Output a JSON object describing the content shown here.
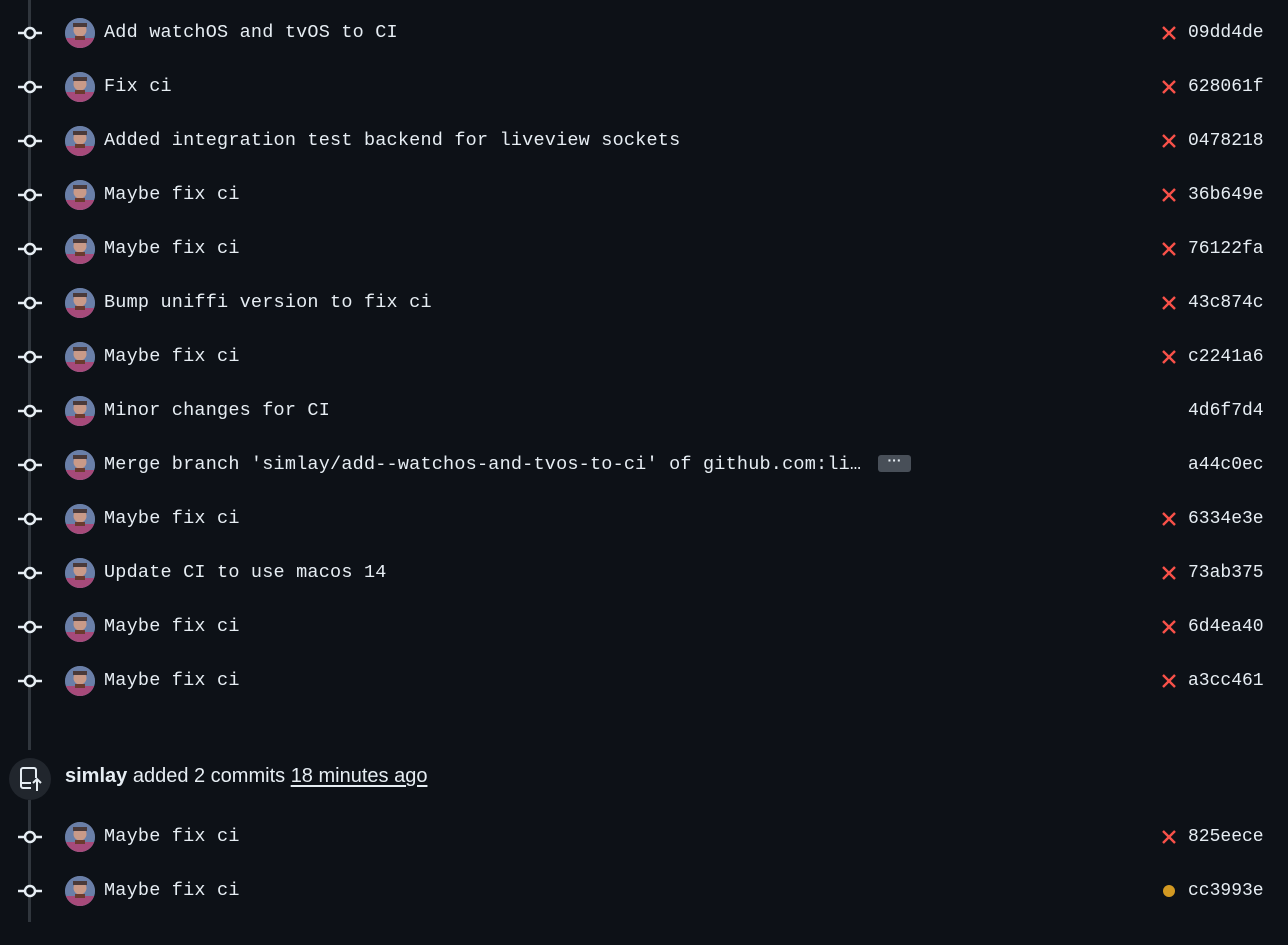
{
  "colors": {
    "background": "#0d1117",
    "timeline": "#30363d",
    "failure": "#f85149",
    "pending": "#d29922",
    "text": "#e6edf3"
  },
  "commits": [
    {
      "message": "Add watchOS and tvOS to CI",
      "sha": "09dd4de",
      "status": "failure"
    },
    {
      "message": "Fix ci",
      "sha": "628061f",
      "status": "failure"
    },
    {
      "message": "Added integration test backend for liveview sockets",
      "sha": "0478218",
      "status": "failure"
    },
    {
      "message": "Maybe fix ci",
      "sha": "36b649e",
      "status": "failure"
    },
    {
      "message": "Maybe fix ci",
      "sha": "76122fa",
      "status": "failure"
    },
    {
      "message": "Bump uniffi version to fix ci",
      "sha": "43c874c",
      "status": "failure"
    },
    {
      "message": "Maybe fix ci",
      "sha": "c2241a6",
      "status": "failure"
    },
    {
      "message": "Minor changes for CI",
      "sha": "4d6f7d4",
      "status": "none"
    },
    {
      "message": "Merge branch 'simlay/add--watchos-and-tvos-to-ci' of github.com:livev…",
      "sha": "a44c0ec",
      "status": "none",
      "expandable": true,
      "expand_label": "···"
    },
    {
      "message": "Maybe fix ci",
      "sha": "6334e3e",
      "status": "failure"
    },
    {
      "message": "Update CI to use macos 14",
      "sha": "73ab375",
      "status": "failure"
    },
    {
      "message": "Maybe fix ci",
      "sha": "6d4ea40",
      "status": "failure"
    },
    {
      "message": "Maybe fix ci",
      "sha": "a3cc461",
      "status": "failure"
    }
  ],
  "push_event": {
    "author": "simlay",
    "action": "added 2 commits",
    "time": "18 minutes ago",
    "icon": "repo-push-icon"
  },
  "pushed_commits": [
    {
      "message": "Maybe fix ci",
      "sha": "825eece",
      "status": "failure"
    },
    {
      "message": "Maybe fix ci",
      "sha": "cc3993e",
      "status": "pending"
    }
  ]
}
